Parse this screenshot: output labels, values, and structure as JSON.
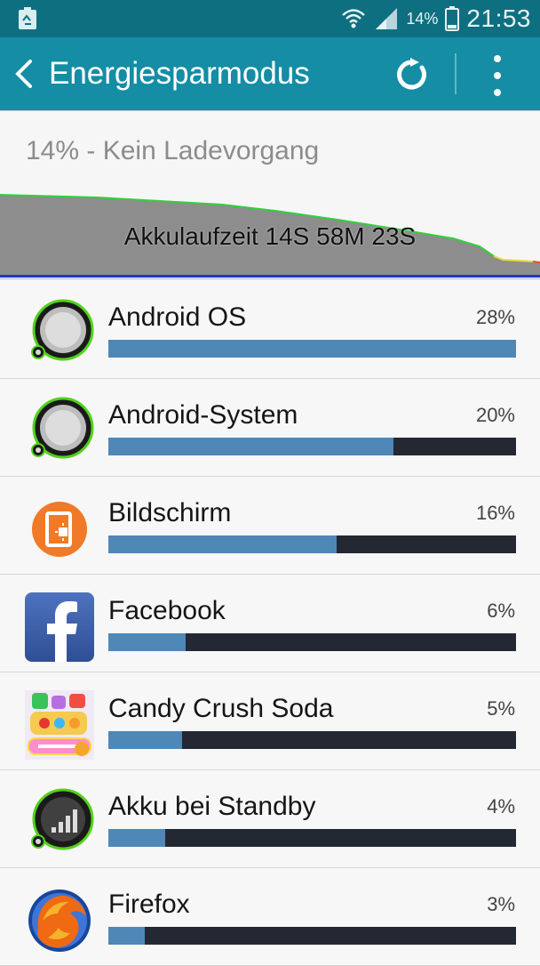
{
  "status": {
    "battery_percent": "14%",
    "time": "21:53"
  },
  "appbar": {
    "title": "Energiesparmodus"
  },
  "summary": {
    "text": "14% - Kein Ladevorgang"
  },
  "graph": {
    "label": "Akkulaufzeit 14S 58M 23S"
  },
  "apps": [
    {
      "name": "Android OS",
      "percent": "28%",
      "bar_fraction": 1.0,
      "icon": "android-os-icon"
    },
    {
      "name": "Android-System",
      "percent": "20%",
      "bar_fraction": 0.7,
      "icon": "android-system-icon"
    },
    {
      "name": "Bildschirm",
      "percent": "16%",
      "bar_fraction": 0.56,
      "icon": "screen-icon"
    },
    {
      "name": "Facebook",
      "percent": "6%",
      "bar_fraction": 0.19,
      "icon": "facebook-icon"
    },
    {
      "name": "Candy Crush Soda",
      "percent": "5%",
      "bar_fraction": 0.18,
      "icon": "candy-crush-soda-icon"
    },
    {
      "name": "Akku bei Standby",
      "percent": "4%",
      "bar_fraction": 0.14,
      "icon": "cell-standby-icon"
    },
    {
      "name": "Firefox",
      "percent": "3%",
      "bar_fraction": 0.09,
      "icon": "firefox-icon"
    }
  ],
  "colors": {
    "statusbar": "#0e6f80",
    "appbar": "#148da5",
    "bar_fill": "#4f87b7",
    "bar_track": "#232833",
    "graph_line_blue": "#2234c8"
  }
}
